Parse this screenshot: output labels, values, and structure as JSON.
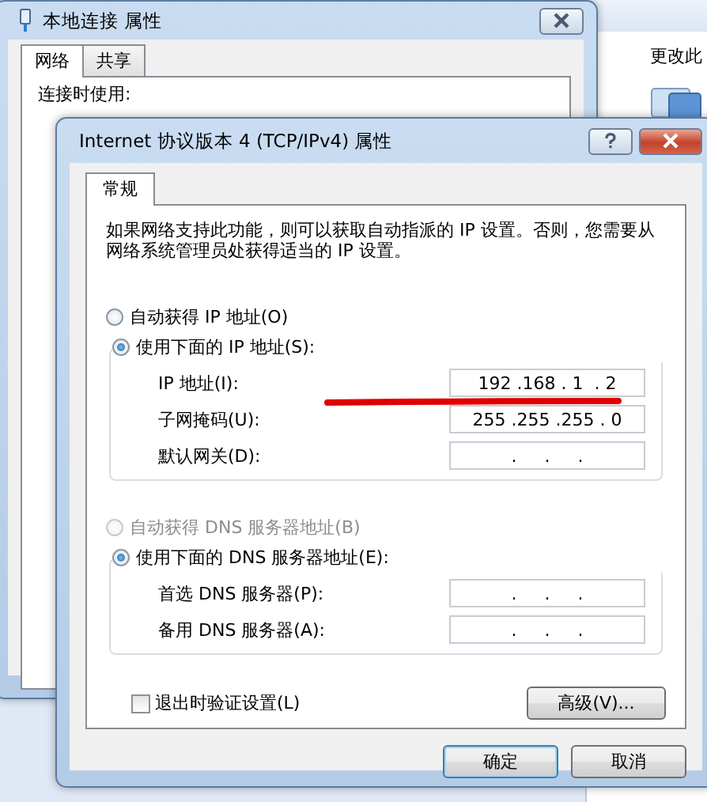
{
  "background_window": {
    "title": "本地连接 属性",
    "tabs": [
      {
        "label": "网络",
        "selected": true
      },
      {
        "label": "共享",
        "selected": false
      }
    ],
    "partial_text": "连接时使用:"
  },
  "behind_window": {
    "toolbar_text": "更改此"
  },
  "dialog": {
    "title": "Internet 协议版本 4 (TCP/IPv4) 属性",
    "tabs": [
      {
        "label": "常规",
        "selected": true
      }
    ],
    "description": "如果网络支持此功能，则可以获取自动指派的 IP 设置。否则，您需要从网络系统管理员处获得适当的 IP 设置。",
    "ip_options": [
      {
        "label": "自动获得 IP 地址(O)",
        "selected": false,
        "disabled": false
      },
      {
        "label": "使用下面的 IP 地址(S):",
        "selected": true,
        "disabled": false
      }
    ],
    "ip_fields": [
      {
        "label": "IP 地址(I):",
        "value": "192 .168 . 1  . 2"
      },
      {
        "label": "子网掩码(U):",
        "value": "255 .255 .255 . 0"
      },
      {
        "label": "默认网关(D):",
        "value": ".     .     ."
      }
    ],
    "dns_options": [
      {
        "label": "自动获得 DNS 服务器地址(B)",
        "selected": false,
        "disabled": true
      },
      {
        "label": "使用下面的 DNS 服务器地址(E):",
        "selected": true,
        "disabled": false
      }
    ],
    "dns_fields": [
      {
        "label": "首选 DNS 服务器(P):",
        "value": ".     .     ."
      },
      {
        "label": "备用 DNS 服务器(A):",
        "value": ".     .     ."
      }
    ],
    "validate_checkbox": {
      "label": "退出时验证设置(L)",
      "checked": false
    },
    "advanced_button": "高级(V)...",
    "buttons": [
      "确定",
      "取消"
    ]
  }
}
